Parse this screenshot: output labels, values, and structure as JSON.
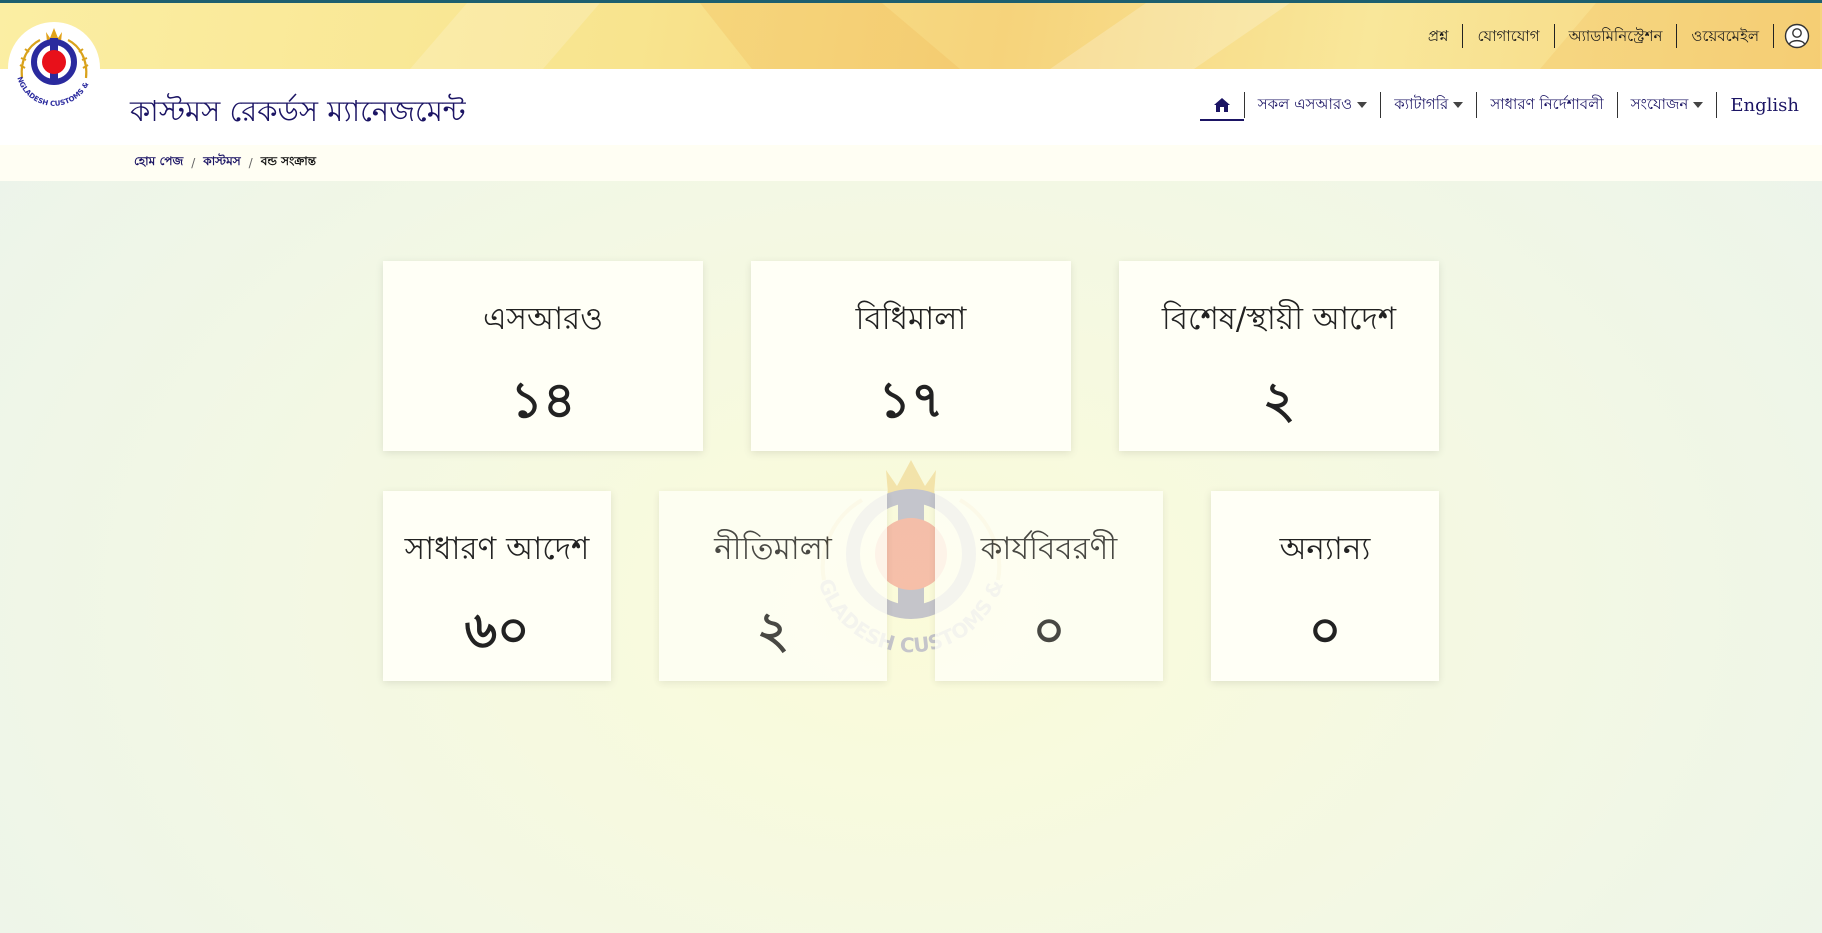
{
  "header": {
    "top_links": [
      "প্রশ্ন",
      "যোগাযোগ",
      "অ্যাডমিনিস্ট্রেশন",
      "ওয়েবমেইল"
    ],
    "brand_title": "কাস্টমস রেকর্ডস ম্যানেজমেন্ট",
    "logo_text": "BANGLADESH CUSTOMS & VAT"
  },
  "nav": {
    "items": [
      "সকল এসআরও",
      "ক্যাটাগরি",
      "সাধারণ নির্দেশাবলী",
      "সংযোজন"
    ],
    "language": "English"
  },
  "breadcrumb": {
    "items": [
      "হোম পেজ",
      "কাস্টমস"
    ],
    "current": "বন্ড সংক্রান্ত"
  },
  "cards": [
    {
      "title": "এসআরও",
      "count": "১৪"
    },
    {
      "title": "বিধিমালা",
      "count": "১৭"
    },
    {
      "title": "বিশেষ/স্থায়ী আদেশ",
      "count": "২"
    },
    {
      "title": "সাধারণ আদেশ",
      "count": "৬০"
    },
    {
      "title": "নীতিমালা",
      "count": "২"
    },
    {
      "title": "কার্যবিবরণী",
      "count": "০"
    },
    {
      "title": "অন্যান্য",
      "count": "০"
    }
  ],
  "colors": {
    "brand": "#1b1464",
    "top_strip": "#1d5f6f",
    "header_gold": "#f6d37b",
    "logo_blue": "#2a2a9e",
    "logo_red": "#e8101a"
  }
}
